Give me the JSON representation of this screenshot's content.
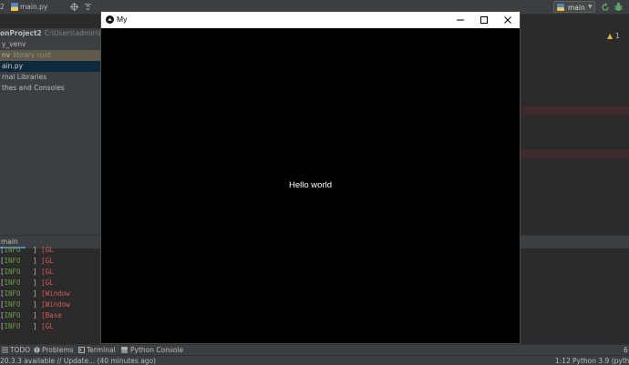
{
  "navbar": {
    "project_name": "2",
    "file_name": "main.py",
    "run_config": "main"
  },
  "project_tree": {
    "root_name": "onProject2",
    "root_path": "C:\\Users\\admin\\Pycharm",
    "venv_folder": "y_venv",
    "venv_lib": "nv",
    "venv_lib_hint": "library root",
    "main_file": "ain.py",
    "external_libs": "rnal Libraries",
    "scratches": "thes and Consoles"
  },
  "editor": {
    "warning_count": "1"
  },
  "run_panel": {
    "tab_label": "main",
    "log": [
      {
        "level": "INFO",
        "src": "GL"
      },
      {
        "level": "INFO",
        "src": "GL"
      },
      {
        "level": "INFO",
        "src": "GL"
      },
      {
        "level": "INFO",
        "src": "GL"
      },
      {
        "level": "INFO",
        "src": "Window"
      },
      {
        "level": "INFO",
        "src": "Window"
      },
      {
        "level": "INFO",
        "src": "Base"
      },
      {
        "level": "INFO",
        "src": "GL"
      }
    ]
  },
  "toolbar": {
    "todo": "TODO",
    "problems": "Problems",
    "terminal": "Terminal",
    "python_console": "Python Console",
    "event_count": "6"
  },
  "status_bar": {
    "message": "20.3.3 available // Update... (40 minutes ago)",
    "position": "1:12",
    "interpreter": "Python 3.9 (pythonP"
  },
  "app_window": {
    "title": "My",
    "body_text": "Hello world"
  },
  "colors": {
    "ide_bg": "#2b2b2b",
    "panel_bg": "#3c3f41",
    "log_level": "#6a9e41",
    "log_source": "#d95656",
    "selection": "#0d293e"
  }
}
